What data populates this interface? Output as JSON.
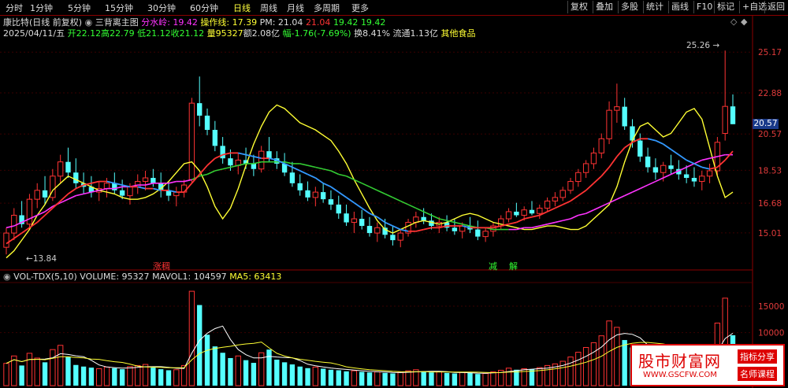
{
  "toolbar": {
    "tabs": [
      "分时",
      "1分钟",
      "5分钟",
      "15分钟",
      "30分钟",
      "60分钟",
      "日线",
      "周线",
      "月线",
      "多周期",
      "更多"
    ],
    "active_tab": "日线",
    "right_buttons": [
      "复权",
      "叠加",
      "多股",
      "统计",
      "画线",
      "F10",
      "标记",
      "+自选",
      "返回"
    ]
  },
  "title": {
    "stock": "康比特(日线 前复权)",
    "indicator_name": "三背离主图",
    "fsl_label": "分水岭: 19.42",
    "czx_label": "操作线: 17.39",
    "pm_label": "PM: 21.04",
    "v1": "21.04",
    "v2": "19.42",
    "v3": "19.42",
    "radio_icon": "radio-icon",
    "settings_icon": "diamond-icon"
  },
  "quote": {
    "date": "2025/04/11/五",
    "open": "开22.12",
    "high": "高22.79",
    "low": "低21.12",
    "close": "收21.12",
    "vol": "量95327",
    "amount": "额2.08亿",
    "change": "幅-1.76(-7.69%)",
    "turnover": "换8.41%",
    "float": "流通1.13亿",
    "sector": "其他食品"
  },
  "price_axis": {
    "labels": [
      "25.17",
      "22.88",
      "20.57",
      "18.53",
      "16.68",
      "15.01"
    ],
    "current": "20.57",
    "high_mark": "25.26",
    "low_mark": "13.84"
  },
  "signals": {
    "s1": "涨稠",
    "s2": "减",
    "s3": "解"
  },
  "volume_title": {
    "name": "VOL-TDX(5,10)",
    "volume": "VOLUME: 95327",
    "mavol1": "MAVOL1: 104597",
    "ma5": "MA5: 63413"
  },
  "volume_axis": {
    "labels": [
      "15000",
      "10000"
    ]
  },
  "watermark": {
    "brand": "股市财富网",
    "url": "WWW.GSCFW.COM",
    "tag1": "指标分享",
    "tag2": "名师课程"
  },
  "colors": {
    "up": "#ff3333",
    "down": "#54ffff",
    "yellow": "#ffff33",
    "green": "#33cc33",
    "blue": "#3399ff",
    "magenta": "#ff33ff",
    "bg": "#000000"
  },
  "chart_data": {
    "type": "candlestick",
    "price_range": [
      13.5,
      25.8
    ],
    "candles": [
      [
        14.2,
        15.3,
        13.8,
        15.0
      ],
      [
        15.0,
        16.4,
        14.6,
        16.0
      ],
      [
        16.0,
        16.8,
        15.3,
        15.5
      ],
      [
        15.5,
        17.2,
        15.2,
        16.9
      ],
      [
        16.9,
        17.8,
        16.4,
        17.4
      ],
      [
        17.4,
        18.2,
        16.6,
        17.0
      ],
      [
        17.0,
        18.6,
        16.8,
        18.2
      ],
      [
        18.2,
        19.4,
        17.8,
        19.0
      ],
      [
        19.0,
        19.8,
        18.1,
        18.4
      ],
      [
        18.4,
        19.2,
        17.5,
        17.8
      ],
      [
        17.8,
        18.4,
        17.2,
        17.6
      ],
      [
        17.6,
        18.2,
        17.0,
        17.3
      ],
      [
        17.3,
        17.9,
        16.8,
        17.5
      ],
      [
        17.5,
        18.1,
        17.0,
        17.8
      ],
      [
        17.8,
        18.4,
        17.2,
        17.4
      ],
      [
        17.4,
        18.0,
        16.9,
        17.1
      ],
      [
        17.1,
        17.8,
        16.6,
        17.6
      ],
      [
        17.6,
        18.3,
        17.2,
        17.9
      ],
      [
        17.9,
        18.5,
        17.4,
        18.1
      ],
      [
        18.1,
        18.6,
        17.6,
        17.8
      ],
      [
        17.8,
        18.4,
        17.0,
        17.4
      ],
      [
        17.4,
        17.9,
        16.8,
        17.1
      ],
      [
        17.1,
        17.6,
        16.5,
        17.3
      ],
      [
        17.3,
        18.0,
        17.0,
        17.7
      ],
      [
        18.0,
        22.6,
        17.8,
        22.3
      ],
      [
        22.3,
        23.8,
        21.0,
        21.6
      ],
      [
        21.6,
        22.0,
        20.5,
        20.8
      ],
      [
        20.8,
        21.3,
        19.6,
        19.9
      ],
      [
        19.9,
        20.4,
        18.9,
        19.2
      ],
      [
        19.2,
        19.7,
        18.5,
        18.8
      ],
      [
        18.8,
        19.5,
        18.3,
        19.1
      ],
      [
        19.1,
        19.8,
        18.6,
        18.9
      ],
      [
        18.9,
        19.4,
        18.2,
        18.6
      ],
      [
        18.6,
        19.9,
        18.4,
        19.6
      ],
      [
        19.6,
        20.4,
        19.0,
        19.2
      ],
      [
        19.2,
        19.6,
        18.6,
        18.9
      ],
      [
        18.9,
        19.5,
        18.2,
        18.4
      ],
      [
        18.4,
        19.0,
        17.6,
        17.8
      ],
      [
        17.8,
        18.3,
        17.1,
        17.4
      ],
      [
        17.4,
        17.9,
        16.8,
        17.0
      ],
      [
        17.0,
        17.6,
        16.5,
        17.3
      ],
      [
        17.3,
        17.8,
        16.7,
        16.9
      ],
      [
        16.9,
        17.4,
        16.3,
        16.6
      ],
      [
        16.6,
        17.1,
        15.8,
        16.1
      ],
      [
        16.1,
        16.6,
        15.4,
        15.6
      ],
      [
        15.6,
        16.2,
        15.0,
        15.8
      ],
      [
        15.8,
        16.3,
        15.2,
        15.4
      ],
      [
        15.4,
        15.9,
        14.8,
        15.0
      ],
      [
        15.0,
        15.6,
        14.5,
        15.3
      ],
      [
        15.3,
        15.8,
        14.7,
        14.9
      ],
      [
        14.9,
        15.4,
        14.3,
        14.6
      ],
      [
        14.6,
        15.2,
        14.2,
        15.0
      ],
      [
        15.0,
        15.8,
        14.8,
        15.6
      ],
      [
        15.6,
        16.2,
        15.3,
        15.9
      ],
      [
        15.9,
        16.4,
        15.5,
        15.7
      ],
      [
        15.7,
        16.1,
        15.2,
        15.4
      ],
      [
        15.4,
        15.9,
        15.0,
        15.6
      ],
      [
        15.6,
        16.0,
        15.1,
        15.3
      ],
      [
        15.3,
        15.8,
        14.9,
        15.1
      ],
      [
        15.1,
        15.6,
        14.7,
        15.4
      ],
      [
        15.4,
        15.9,
        15.0,
        15.2
      ],
      [
        15.2,
        15.7,
        14.6,
        14.8
      ],
      [
        14.8,
        15.3,
        14.5,
        15.1
      ],
      [
        15.1,
        15.6,
        14.8,
        15.4
      ],
      [
        15.4,
        16.0,
        15.2,
        15.8
      ],
      [
        15.8,
        16.4,
        15.6,
        16.2
      ],
      [
        16.2,
        16.7,
        15.9,
        16.0
      ],
      [
        16.0,
        16.5,
        15.7,
        16.3
      ],
      [
        16.3,
        16.8,
        16.0,
        16.1
      ],
      [
        16.1,
        16.6,
        15.8,
        16.4
      ],
      [
        16.4,
        17.0,
        16.2,
        16.8
      ],
      [
        16.8,
        17.3,
        16.5,
        17.0
      ],
      [
        17.0,
        17.6,
        16.8,
        17.4
      ],
      [
        17.4,
        18.1,
        17.2,
        17.9
      ],
      [
        17.9,
        18.6,
        17.6,
        18.4
      ],
      [
        18.4,
        19.1,
        18.1,
        18.9
      ],
      [
        18.9,
        19.8,
        18.6,
        19.5
      ],
      [
        19.5,
        20.6,
        19.2,
        20.3
      ],
      [
        20.3,
        22.4,
        20.0,
        21.9
      ],
      [
        21.9,
        23.4,
        21.2,
        22.1
      ],
      [
        22.1,
        22.6,
        20.8,
        21.0
      ],
      [
        21.0,
        21.4,
        19.8,
        20.2
      ],
      [
        20.2,
        20.6,
        19.0,
        19.3
      ],
      [
        19.3,
        19.8,
        18.4,
        18.7
      ],
      [
        18.7,
        19.2,
        18.0,
        18.4
      ],
      [
        18.4,
        19.0,
        17.9,
        18.8
      ],
      [
        18.8,
        19.4,
        18.3,
        18.6
      ],
      [
        18.6,
        19.1,
        18.0,
        18.3
      ],
      [
        18.3,
        18.8,
        17.8,
        18.1
      ],
      [
        18.1,
        18.7,
        17.6,
        17.9
      ],
      [
        17.9,
        18.5,
        17.4,
        18.2
      ],
      [
        18.2,
        18.9,
        17.8,
        18.5
      ],
      [
        18.5,
        20.4,
        18.2,
        20.1
      ],
      [
        20.6,
        25.26,
        20.2,
        22.12
      ],
      [
        22.12,
        22.79,
        21.12,
        21.12
      ]
    ],
    "vol": [
      4200,
      5600,
      3800,
      6100,
      5200,
      4400,
      6800,
      7600,
      5400,
      3900,
      3600,
      3400,
      3200,
      3500,
      3300,
      3100,
      3600,
      3800,
      4000,
      3400,
      3100,
      2900,
      3000,
      3800,
      17800,
      15200,
      9600,
      7400,
      6200,
      5200,
      5600,
      4800,
      4300,
      6200,
      6800,
      4900,
      4400,
      4000,
      3600,
      3300,
      3500,
      3200,
      3000,
      2900,
      2700,
      2800,
      2600,
      2500,
      2600,
      2400,
      2300,
      2500,
      2800,
      3000,
      2700,
      2500,
      2600,
      2400,
      2300,
      2500,
      2400,
      2200,
      2300,
      2600,
      2900,
      3300,
      3000,
      3200,
      3100,
      3400,
      3800,
      4100,
      4600,
      5400,
      6300,
      7200,
      8100,
      9400,
      12200,
      11000,
      8600,
      7200,
      6100,
      5400,
      5000,
      5600,
      5200,
      4800,
      4600,
      4500,
      5200,
      6400,
      11800,
      16500,
      9500
    ],
    "ma_red": [
      14.4,
      14.7,
      15.0,
      15.3,
      15.6,
      16.0,
      16.4,
      16.8,
      17.2,
      17.5,
      17.7,
      17.8,
      17.9,
      17.9,
      17.8,
      17.7,
      17.6,
      17.6,
      17.5,
      17.5,
      17.4,
      17.4,
      17.3,
      17.3,
      17.8,
      18.3,
      18.8,
      19.2,
      19.4,
      19.5,
      19.5,
      19.4,
      19.3,
      19.2,
      19.2,
      19.1,
      18.9,
      18.7,
      18.5,
      18.3,
      18.1,
      17.8,
      17.6,
      17.3,
      17.0,
      16.7,
      16.4,
      16.1,
      15.9,
      15.6,
      15.4,
      15.2,
      15.1,
      15.1,
      15.2,
      15.3,
      15.3,
      15.4,
      15.4,
      15.4,
      15.3,
      15.3,
      15.3,
      15.3,
      15.4,
      15.5,
      15.6,
      15.8,
      15.9,
      16.0,
      16.2,
      16.4,
      16.6,
      16.8,
      17.1,
      17.4,
      17.8,
      18.2,
      18.7,
      19.3,
      19.8,
      20.1,
      20.3,
      20.3,
      20.2,
      20.0,
      19.7,
      19.4,
      19.1,
      18.9,
      18.7,
      18.6,
      18.7,
      19.1,
      19.6
    ],
    "mid_line": [
      15.3,
      15.4,
      15.6,
      15.8,
      16.0,
      16.2,
      16.5,
      16.7,
      16.9,
      17.1,
      17.2,
      17.3,
      17.4,
      17.5,
      17.5,
      17.6,
      17.6,
      17.7,
      17.7,
      17.8,
      17.8,
      17.8,
      17.9,
      17.9,
      18.0,
      18.2,
      18.3,
      18.5,
      18.6,
      18.7,
      18.8,
      18.9,
      18.9,
      19.0,
      19.0,
      19.0,
      19.0,
      18.9,
      18.9,
      18.8,
      18.7,
      18.6,
      18.5,
      18.3,
      18.2,
      18.0,
      17.8,
      17.6,
      17.4,
      17.2,
      17.0,
      16.8,
      16.6,
      16.4,
      16.2,
      16.0,
      15.8,
      15.7,
      15.6,
      15.5,
      15.4,
      15.3,
      15.3,
      15.2,
      15.2,
      15.2,
      15.2,
      15.3,
      15.3,
      15.4,
      15.5,
      15.6,
      15.7,
      15.8,
      16.0,
      16.1,
      16.3,
      16.5,
      16.7,
      16.9,
      17.1,
      17.3,
      17.5,
      17.7,
      17.9,
      18.1,
      18.3,
      18.5,
      18.7,
      18.9,
      19.1,
      19.2,
      19.3,
      19.4,
      19.4
    ],
    "yellow": [
      13.6,
      14.0,
      14.6,
      15.2,
      16.0,
      16.6,
      17.4,
      17.8,
      18.2,
      18.0,
      17.8,
      17.6,
      17.4,
      17.3,
      17.2,
      17.0,
      16.9,
      16.9,
      17.0,
      17.2,
      17.5,
      17.9,
      18.4,
      18.9,
      19.0,
      18.5,
      17.6,
      16.5,
      15.8,
      16.4,
      17.5,
      18.8,
      20.0,
      21.0,
      21.8,
      22.2,
      22.0,
      21.6,
      21.2,
      21.0,
      20.8,
      20.5,
      20.2,
      19.6,
      18.9,
      18.0,
      17.2,
      16.4,
      15.7,
      15.2,
      15.0,
      15.2,
      15.4,
      15.6,
      15.7,
      15.6,
      15.5,
      15.6,
      15.8,
      16.0,
      16.1,
      16.0,
      15.8,
      15.6,
      15.5,
      15.4,
      15.3,
      15.2,
      15.2,
      15.3,
      15.4,
      15.4,
      15.3,
      15.2,
      15.2,
      15.4,
      15.8,
      16.2,
      16.6,
      17.6,
      19.0,
      20.2,
      21.0,
      21.2,
      20.8,
      20.4,
      20.6,
      21.2,
      21.8,
      22.0,
      21.4,
      19.8,
      18.2,
      17.0,
      17.3
    ]
  }
}
